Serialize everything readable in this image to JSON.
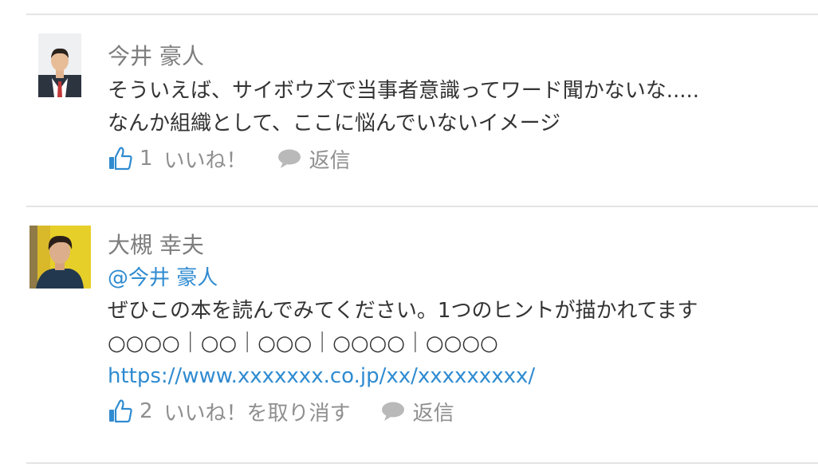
{
  "comments": [
    {
      "author": "今井 豪人",
      "lines": [
        "そういえば、サイボウズで当事者意識ってワード聞かないな.....",
        "なんか組織として、ここに悩んでいないイメージ"
      ],
      "likes": {
        "count": "1",
        "label": "いいね！"
      },
      "reply_label": "返信"
    },
    {
      "author": "大槻 幸夫",
      "mention": "@今井 豪人",
      "lines": [
        "ぜひこの本を読んでみてください。1つのヒントが描かれてます",
        "○○○○｜○○｜○○○｜○○○○｜○○○○"
      ],
      "link": "https://www.xxxxxxx.co.jp/xx/xxxxxxxxx/",
      "likes": {
        "count": "2",
        "label": "いいね！を取り消す"
      },
      "reply_label": "返信"
    }
  ],
  "icons": [
    "thumbs-up-icon",
    "speech-bubble-icon"
  ],
  "colors": {
    "accent": "#2f8bd0",
    "text": "#333333",
    "muted": "#8f8f8f",
    "divider": "#e4e4e4"
  }
}
